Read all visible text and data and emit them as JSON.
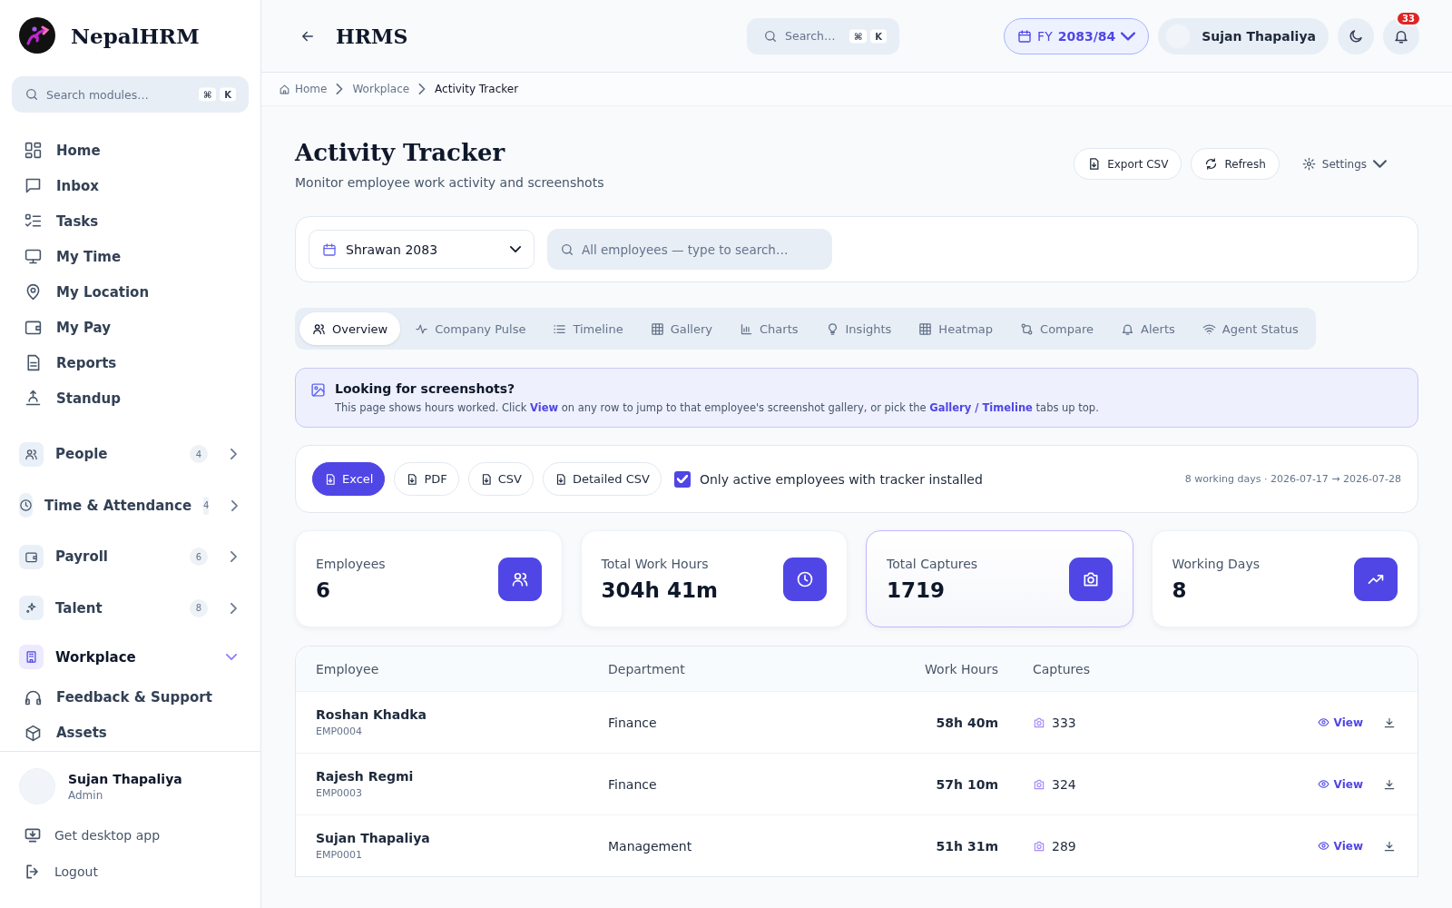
{
  "brand": {
    "name": "NepalHRM"
  },
  "sidebar": {
    "search": {
      "placeholder": "Search modules…",
      "keys": [
        "⌘",
        "K"
      ]
    },
    "items": [
      {
        "kind": "link",
        "label": "Home"
      },
      {
        "kind": "link",
        "label": "Inbox"
      },
      {
        "kind": "link",
        "label": "Tasks"
      },
      {
        "kind": "link",
        "label": "My Time"
      },
      {
        "kind": "link",
        "label": "My Location"
      },
      {
        "kind": "link",
        "label": "My Pay"
      },
      {
        "kind": "link",
        "label": "Reports"
      },
      {
        "kind": "link",
        "label": "Standup"
      },
      {
        "kind": "group",
        "label": "People",
        "count": "4",
        "expanded": false
      },
      {
        "kind": "group",
        "label": "Time & Attendance",
        "count": "4",
        "expanded": false
      },
      {
        "kind": "group",
        "label": "Payroll",
        "count": "6",
        "expanded": false
      },
      {
        "kind": "group",
        "label": "Talent",
        "count": "8",
        "expanded": false
      },
      {
        "kind": "group",
        "label": "Workplace",
        "expanded": true,
        "children": [
          {
            "label": "Feedback & Support"
          },
          {
            "label": "Assets"
          }
        ]
      }
    ],
    "user": {
      "name": "Sujan Thapaliya",
      "role": "Admin"
    },
    "footer_links": [
      "Get desktop app",
      "Logout"
    ]
  },
  "header": {
    "title": "HRMS",
    "search": {
      "placeholder": "Search…",
      "keys": [
        "⌘",
        "K"
      ]
    },
    "fiscal_year": "FY **2083/84**",
    "user_name": "Sujan Thapaliya",
    "notifications": "33"
  },
  "breadcrumb": [
    "Home",
    "Workplace",
    "Activity Tracker"
  ],
  "page": {
    "title": "Activity Tracker",
    "subtitle": "Monitor employee work activity and screenshots",
    "actions": [
      "Export CSV",
      "Refresh",
      "Settings"
    ]
  },
  "filters": {
    "period": "Shrawan 2083",
    "employee_search": {
      "placeholder": "All employees — type to search…"
    }
  },
  "tabs": [
    {
      "label": "Overview",
      "selected": true
    },
    {
      "label": "Company Pulse",
      "selected": false
    },
    {
      "label": "Timeline",
      "selected": false
    },
    {
      "label": "Gallery",
      "selected": false
    },
    {
      "label": "Charts",
      "selected": false
    },
    {
      "label": "Insights",
      "selected": false
    },
    {
      "label": "Heatmap",
      "selected": false
    },
    {
      "label": "Compare",
      "selected": false
    },
    {
      "label": "Alerts",
      "selected": false
    },
    {
      "label": "Agent Status",
      "selected": false
    }
  ],
  "banner": {
    "title": "Looking for screenshots?",
    "body": [
      {
        "kind": "text",
        "text": "This page shows hours worked. Click "
      },
      {
        "kind": "link",
        "text": "View"
      },
      {
        "kind": "text",
        "text": " on any row to jump to that employee's screenshot gallery, or pick the "
      },
      {
        "kind": "link",
        "text": "Gallery / Timeline"
      },
      {
        "kind": "text",
        "text": " tabs up top."
      }
    ]
  },
  "exports": {
    "buttons": [
      {
        "label": "Excel",
        "selected": true
      },
      {
        "label": "PDF",
        "selected": false
      },
      {
        "label": "CSV",
        "selected": false
      },
      {
        "label": "Detailed CSV",
        "selected": false
      }
    ],
    "active_only": {
      "label": "Only active employees with tracker installed",
      "checked": true
    },
    "range": "8 working days · 2026-07-17 → 2026-07-28"
  },
  "stats": [
    {
      "label": "Employees",
      "value": "6",
      "selected": false
    },
    {
      "label": "Total Work Hours",
      "value": "304h 41m",
      "selected": false
    },
    {
      "label": "Total Captures",
      "value": "1719",
      "selected": true
    },
    {
      "label": "Working Days",
      "value": "8",
      "selected": false
    }
  ],
  "table": {
    "columns": [
      "Employee",
      "Department",
      "Work Hours",
      "Captures"
    ],
    "rows": [
      {
        "name": "Roshan Khadka",
        "id": "EMP0004",
        "department": "Finance",
        "hours": "58h 40m",
        "captures": "333",
        "action": "View"
      },
      {
        "name": "Rajesh Regmi",
        "id": "EMP0003",
        "department": "Finance",
        "hours": "57h 10m",
        "captures": "324",
        "action": "View"
      },
      {
        "name": "Sujan Thapaliya",
        "id": "EMP0001",
        "department": "Management",
        "hours": "51h 31m",
        "captures": "289",
        "action": "View"
      }
    ]
  }
}
